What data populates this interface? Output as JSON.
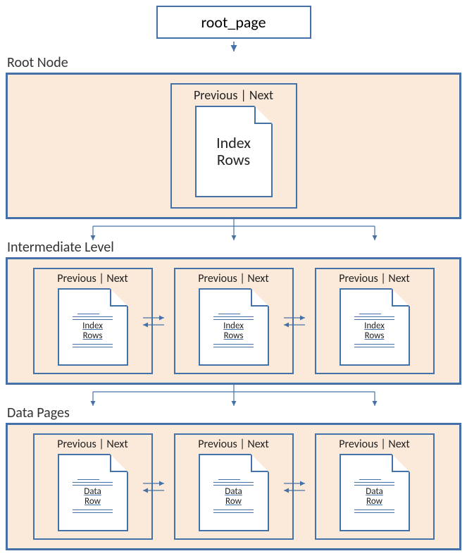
{
  "top_box": "root_page",
  "levels": [
    {
      "label": "Root Node",
      "nodes": [
        {
          "header": "Previous  |  Next",
          "page_text": "Index\nRows",
          "big": true
        }
      ]
    },
    {
      "label": "Intermediate Level",
      "nodes": [
        {
          "header": "Previous  |  Next",
          "page_text": "Index\nRows"
        },
        {
          "header": "Previous  |  Next",
          "page_text": "Index\nRows"
        },
        {
          "header": "Previous  |  Next",
          "page_text": "Index\nRows"
        }
      ]
    },
    {
      "label": "Data Pages",
      "nodes": [
        {
          "header": "Previous  |  Next",
          "page_text": "Data\nRow"
        },
        {
          "header": "Previous  |  Next",
          "page_text": "Data\nRow"
        },
        {
          "header": "Previous  |  Next",
          "page_text": "Data\nRow"
        }
      ]
    }
  ],
  "colors": {
    "border": "#4472a8",
    "fill": "#fbe9d9"
  }
}
